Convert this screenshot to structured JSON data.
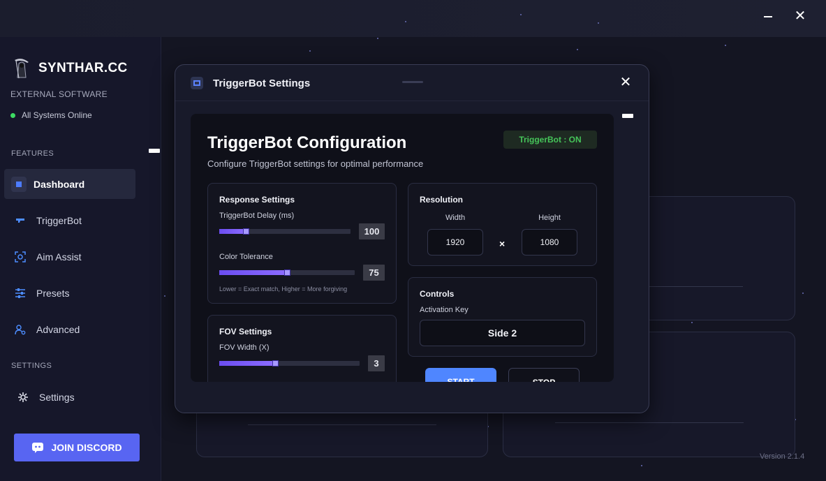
{
  "window": {
    "minimize_icon": "minimize-icon",
    "close_icon": "close-icon",
    "close_glyph": "✕"
  },
  "sidebar": {
    "brand": "SYNTHAR.CC",
    "subtitle": "EXTERNAL SOFTWARE",
    "status": "All Systems Online",
    "features_label": "FEATURES",
    "settings_label": "SETTINGS",
    "items": [
      {
        "label": "Dashboard",
        "icon": "dashboard-icon",
        "active": true
      },
      {
        "label": "TriggerBot",
        "icon": "gun-icon"
      },
      {
        "label": "Aim Assist",
        "icon": "crosshair-icon"
      },
      {
        "label": "Presets",
        "icon": "sliders-icon"
      },
      {
        "label": "Advanced",
        "icon": "user-gear-icon"
      }
    ],
    "settings_item": {
      "label": "Settings",
      "icon": "gear-icon"
    },
    "discord_label": "JOIN DISCORD"
  },
  "version": "Version 2.1.4",
  "modal": {
    "title": "TriggerBot Settings",
    "close_glyph": "✕",
    "heading": "TriggerBot Configuration",
    "subheading": "Configure TriggerBot settings for optimal performance",
    "status_pill": "TriggerBot : ON",
    "response": {
      "title": "Response Settings",
      "delay_label": "TriggerBot Delay (ms)",
      "delay_value": "100",
      "delay_fraction": 0.2,
      "tolerance_label": "Color Tolerance",
      "tolerance_value": "75",
      "tolerance_fraction": 0.5,
      "tolerance_hint": "Lower = Exact match, Higher = More forgiving"
    },
    "fov": {
      "title": "FOV Settings",
      "width_label": "FOV Width (X)",
      "width_value": "3",
      "width_fraction": 0.4
    },
    "resolution": {
      "title": "Resolution",
      "width_label": "Width",
      "height_label": "Height",
      "width_value": "1920",
      "height_value": "1080",
      "separator": "×"
    },
    "controls": {
      "title": "Controls",
      "key_label": "Activation Key",
      "key_value": "Side 2"
    },
    "start_label": "START",
    "stop_label": "STOP"
  }
}
